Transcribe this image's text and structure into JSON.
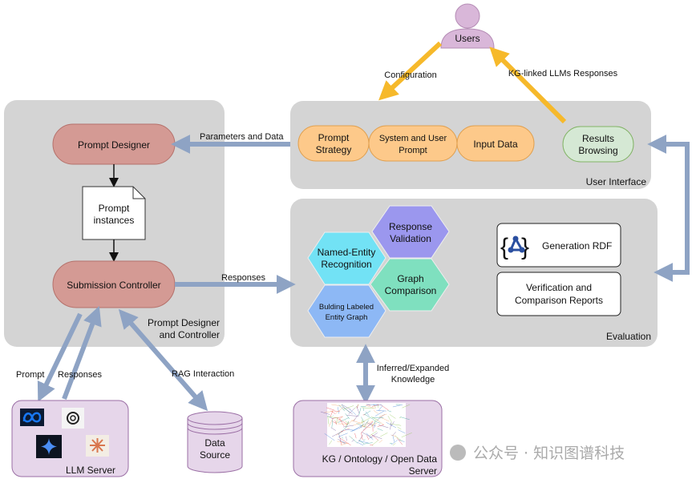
{
  "users": {
    "label": "Users"
  },
  "edges": {
    "configuration": "Configuration",
    "kg_linked": "KG-linked LLMs Responses",
    "parameters": "Parameters and Data",
    "responses": "Responses",
    "prompt": "Prompt",
    "llm_responses": "Responses",
    "rag": "RAG Interaction",
    "inferred": [
      "Inferred/Expanded",
      "Knowledge"
    ]
  },
  "prompt_panel": {
    "title": [
      "Prompt Designer",
      "and Controller"
    ],
    "prompt_designer": "Prompt Designer",
    "prompt_instances": [
      "Prompt",
      "instances"
    ],
    "submission_controller": "Submission Controller"
  },
  "ui_panel": {
    "title": "User Interface",
    "prompt_strategy": [
      "Prompt",
      "Strategy"
    ],
    "system_user_prompt": [
      "System and User",
      "Prompt"
    ],
    "input_data": "Input Data",
    "results_browsing": [
      "Results",
      "Browsing"
    ]
  },
  "evaluation": {
    "title": "Evaluation",
    "response_validation": [
      "Response",
      "Validation"
    ],
    "ner": [
      "Named-Entity",
      "Recognition"
    ],
    "graph_comparison": [
      "Graph",
      "Comparison"
    ],
    "building_graph": [
      "Bulding Labeled",
      "Entity Graph"
    ],
    "generation_rdf": "Generation RDF",
    "reports": [
      "Verification and",
      "Comparison Reports"
    ]
  },
  "llm_server": {
    "label": "LLM Server",
    "logos": [
      "meta-logo",
      "openai-logo",
      "gemini-logo",
      "claude-logo"
    ]
  },
  "data_source": {
    "label": [
      "Data",
      "Source"
    ]
  },
  "kg_server": {
    "label": [
      "KG / Ontology / Open Data",
      "Server"
    ]
  },
  "watermark": "公众号 · 知识图谱科技",
  "colors": {
    "panel": "#d4d4d4",
    "pill_red": "#d49a94",
    "pill_orange": "#fdc98a",
    "pill_green": "#d5e8d4",
    "arrow_blue": "#8ea3c4",
    "arrow_yellow": "#f6b92b",
    "server": "#e6d6ea"
  }
}
